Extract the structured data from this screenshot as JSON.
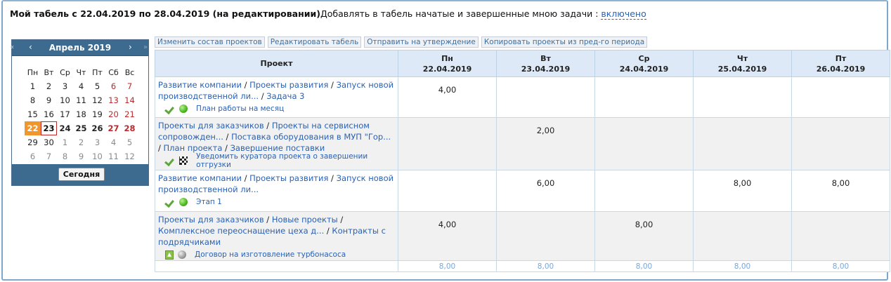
{
  "header": {
    "title": "Мой табель с 22.04.2019 по 28.04.2019 (на редактировании)",
    "setting_text": "Добавлять в табель начатые и завершенные мною задачи :",
    "setting_value": "включено"
  },
  "calendar": {
    "prev_year": "«",
    "prev": "‹",
    "month": "Апрель 2019",
    "next": "›",
    "next_year": "»",
    "weekdays": [
      "Пн",
      "Вт",
      "Ср",
      "Чт",
      "Пт",
      "Сб",
      "Вс"
    ],
    "weeks": [
      [
        "1",
        "2",
        "3",
        "4",
        "5",
        "6",
        "7"
      ],
      [
        "8",
        "9",
        "10",
        "11",
        "12",
        "13",
        "14"
      ],
      [
        "15",
        "16",
        "17",
        "18",
        "19",
        "20",
        "21"
      ],
      [
        "22",
        "23",
        "24",
        "25",
        "26",
        "27",
        "28"
      ],
      [
        "29",
        "30",
        "1",
        "2",
        "3",
        "4",
        "5"
      ],
      [
        "6",
        "7",
        "8",
        "9",
        "10",
        "11",
        "12"
      ]
    ],
    "today_button": "Сегодня"
  },
  "toolbar": {
    "change_projects": "Изменить состав проектов",
    "edit_timesheet": "Редактировать табель",
    "send_for_approval": "Отправить на утверждение",
    "copy_projects": "Копировать проекты из пред-го периода"
  },
  "table": {
    "project_header": "Проект",
    "days": [
      {
        "dow": "Пн",
        "date": "22.04.2019"
      },
      {
        "dow": "Вт",
        "date": "23.04.2019"
      },
      {
        "dow": "Ср",
        "date": "24.04.2019"
      },
      {
        "dow": "Чт",
        "date": "25.04.2019"
      },
      {
        "dow": "Пт",
        "date": "26.04.2019"
      }
    ],
    "rows": [
      {
        "path": [
          "Развитие компании",
          "Проекты развития",
          "Запуск новой производственной ли...",
          "Задача 3"
        ],
        "task": "План работы на месяц",
        "hours": [
          "4,00",
          "",
          "",
          "",
          ""
        ]
      },
      {
        "path": [
          "Проекты для заказчиков",
          "Проекты на сервисном сопровожден...",
          "Поставка оборудования в МУП \"Гор...",
          "План проекта",
          "Завершение поставки"
        ],
        "task": "Уведомить куратора проекта о завершении отгрузки",
        "hours": [
          "",
          "2,00",
          "",
          "",
          ""
        ]
      },
      {
        "path": [
          "Развитие компании",
          "Проекты развития",
          "Запуск новой производственной ли..."
        ],
        "task": "Этап 1",
        "hours": [
          "",
          "6,00",
          "",
          "8,00",
          "8,00"
        ]
      },
      {
        "path": [
          "Проекты для заказчиков",
          "Новые проекты",
          "Комплексное переоснащение цеха д...",
          "Контракты с подрядчиками"
        ],
        "task": "Договор на изготовление турбонасоса",
        "hours": [
          "4,00",
          "",
          "8,00",
          "",
          ""
        ]
      }
    ],
    "totals": [
      "8,00",
      "8,00",
      "8,00",
      "8,00",
      "8,00"
    ]
  }
}
